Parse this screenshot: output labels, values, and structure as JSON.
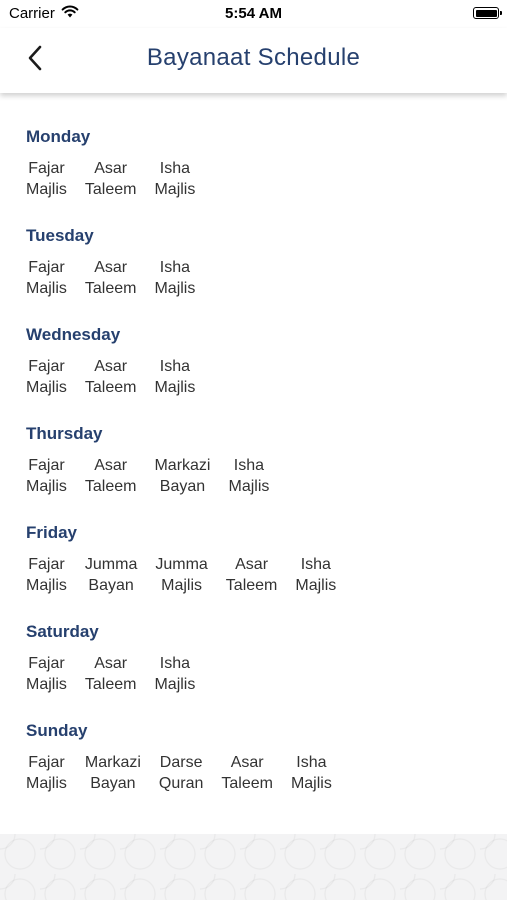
{
  "status_bar": {
    "carrier": "Carrier",
    "time": "5:54 AM"
  },
  "header": {
    "title": "Bayanaat Schedule"
  },
  "days": [
    {
      "name": "Monday",
      "slots": [
        {
          "line1": "Fajar",
          "line2": "Majlis"
        },
        {
          "line1": "Asar",
          "line2": "Taleem"
        },
        {
          "line1": "Isha",
          "line2": "Majlis"
        }
      ]
    },
    {
      "name": "Tuesday",
      "slots": [
        {
          "line1": "Fajar",
          "line2": "Majlis"
        },
        {
          "line1": "Asar",
          "line2": "Taleem"
        },
        {
          "line1": "Isha",
          "line2": "Majlis"
        }
      ]
    },
    {
      "name": "Wednesday",
      "slots": [
        {
          "line1": "Fajar",
          "line2": "Majlis"
        },
        {
          "line1": "Asar",
          "line2": "Taleem"
        },
        {
          "line1": "Isha",
          "line2": "Majlis"
        }
      ]
    },
    {
      "name": "Thursday",
      "slots": [
        {
          "line1": "Fajar",
          "line2": "Majlis"
        },
        {
          "line1": "Asar",
          "line2": "Taleem"
        },
        {
          "line1": "Markazi",
          "line2": "Bayan"
        },
        {
          "line1": "Isha",
          "line2": "Majlis"
        }
      ]
    },
    {
      "name": "Friday",
      "slots": [
        {
          "line1": "Fajar",
          "line2": "Majlis"
        },
        {
          "line1": "Jumma",
          "line2": "Bayan"
        },
        {
          "line1": "Jumma",
          "line2": "Majlis"
        },
        {
          "line1": "Asar",
          "line2": "Taleem"
        },
        {
          "line1": "Isha",
          "line2": "Majlis"
        }
      ]
    },
    {
      "name": "Saturday",
      "slots": [
        {
          "line1": "Fajar",
          "line2": "Majlis"
        },
        {
          "line1": "Asar",
          "line2": "Taleem"
        },
        {
          "line1": "Isha",
          "line2": "Majlis"
        }
      ]
    },
    {
      "name": "Sunday",
      "slots": [
        {
          "line1": "Fajar",
          "line2": "Majlis"
        },
        {
          "line1": "Markazi",
          "line2": "Bayan"
        },
        {
          "line1": "Darse",
          "line2": "Quran"
        },
        {
          "line1": "Asar",
          "line2": "Taleem"
        },
        {
          "line1": "Isha",
          "line2": "Majlis"
        }
      ]
    }
  ],
  "colors": {
    "title": "#26406e",
    "day_heading": "#26406e",
    "text": "#333333"
  },
  "icons": {
    "back": "chevron-left-icon",
    "wifi": "wifi-icon",
    "battery": "battery-icon"
  }
}
